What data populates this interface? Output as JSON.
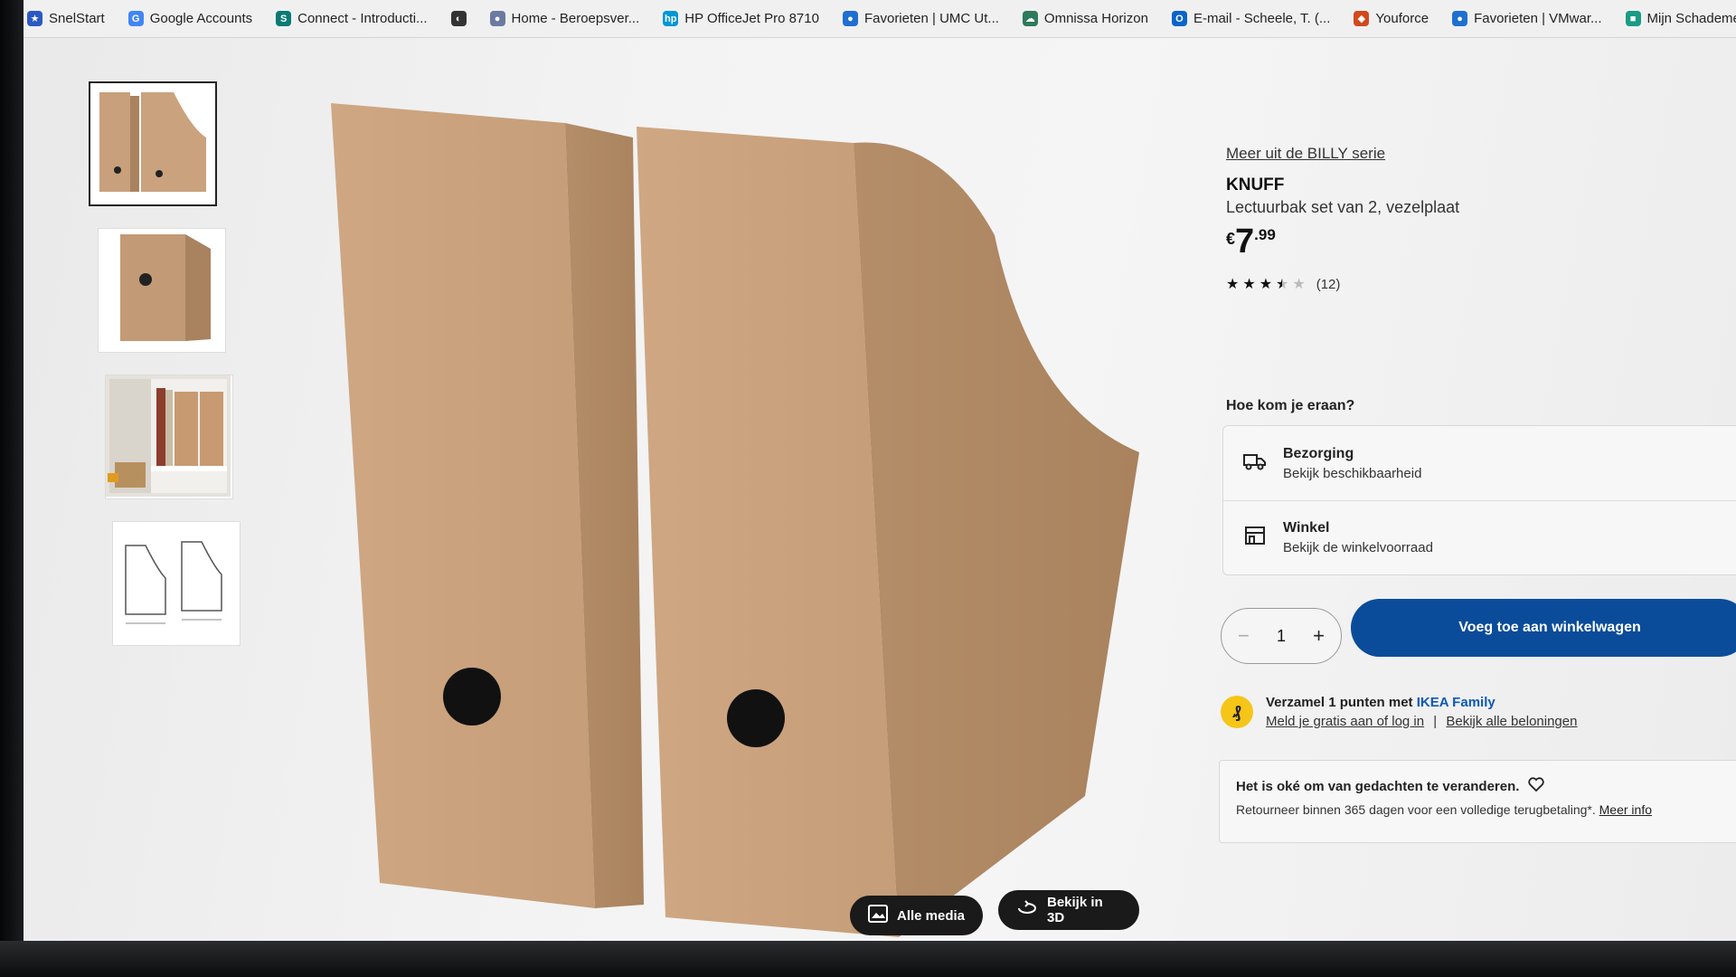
{
  "bookmarks": [
    {
      "label": "SnelStart",
      "icon": "star-icon",
      "color": "#2b59c3"
    },
    {
      "label": "Google Accounts",
      "icon": "google-icon",
      "color": "#4285f4"
    },
    {
      "label": "Connect - Introducti...",
      "icon": "sharepoint-icon",
      "color": "#0b7a75"
    },
    {
      "label": "",
      "icon": "globe-icon",
      "color": "#333333"
    },
    {
      "label": "Home - Beroepsver...",
      "icon": "site-icon",
      "color": "#6b7aa1"
    },
    {
      "label": "HP OfficeJet Pro 8710",
      "icon": "hp-icon",
      "color": "#0096d6"
    },
    {
      "label": "Favorieten | UMC Ut...",
      "icon": "drop-icon",
      "color": "#1f6fd1"
    },
    {
      "label": "Omnissa Horizon",
      "icon": "cloud-icon",
      "color": "#2f7a5a"
    },
    {
      "label": "E-mail - Scheele, T. (...",
      "icon": "outlook-icon",
      "color": "#0a64c8"
    },
    {
      "label": "Youforce",
      "icon": "shield-icon",
      "color": "#d04a1d"
    },
    {
      "label": "Favorieten | VMwar...",
      "icon": "drop-icon",
      "color": "#1f6fd1"
    },
    {
      "label": "Mijn Schademeldin...",
      "icon": "report-icon",
      "color": "#1a9b86"
    }
  ],
  "product": {
    "series_link": "Meer uit de BILLY serie",
    "name": "KNUFF",
    "description": "Lectuurbak set van 2, vezelplaat",
    "price_currency": "€",
    "price_int": "7",
    "price_dec": ".99",
    "rating": 3.5,
    "review_count": "(12)"
  },
  "media_buttons": {
    "all_media": "Alle media",
    "view_3d": "Bekijk in 3D"
  },
  "delivery": {
    "heading": "Hoe kom je eraan?",
    "options": [
      {
        "title": "Bezorging",
        "sub": "Bekijk beschikbaarheid",
        "icon": "truck-icon"
      },
      {
        "title": "Winkel",
        "sub": "Bekijk de winkelvoorraad",
        "icon": "store-icon"
      }
    ]
  },
  "cart": {
    "quantity": "1",
    "minus": "−",
    "plus": "+",
    "add_label": "Voeg toe aan winkelwagen"
  },
  "family": {
    "badge": "₰",
    "line1_prefix": "Verzamel 1 punten met ",
    "line1_brand": "IKEA Family",
    "link_login": "Meld je gratis aan of log in",
    "separator": "|",
    "link_rewards": "Bekijk alle beloningen"
  },
  "returns": {
    "title": "Het is oké om van gedachten te veranderen.",
    "text": "Retourneer binnen 365 dagen voor een volledige terugbetaling*. ",
    "link": "Meer info"
  },
  "colors": {
    "accent": "#0b4c9a",
    "family_yellow": "#f5c518",
    "ikea_family_blue": "#0b58b8",
    "cardboard": "#c79f7d"
  }
}
